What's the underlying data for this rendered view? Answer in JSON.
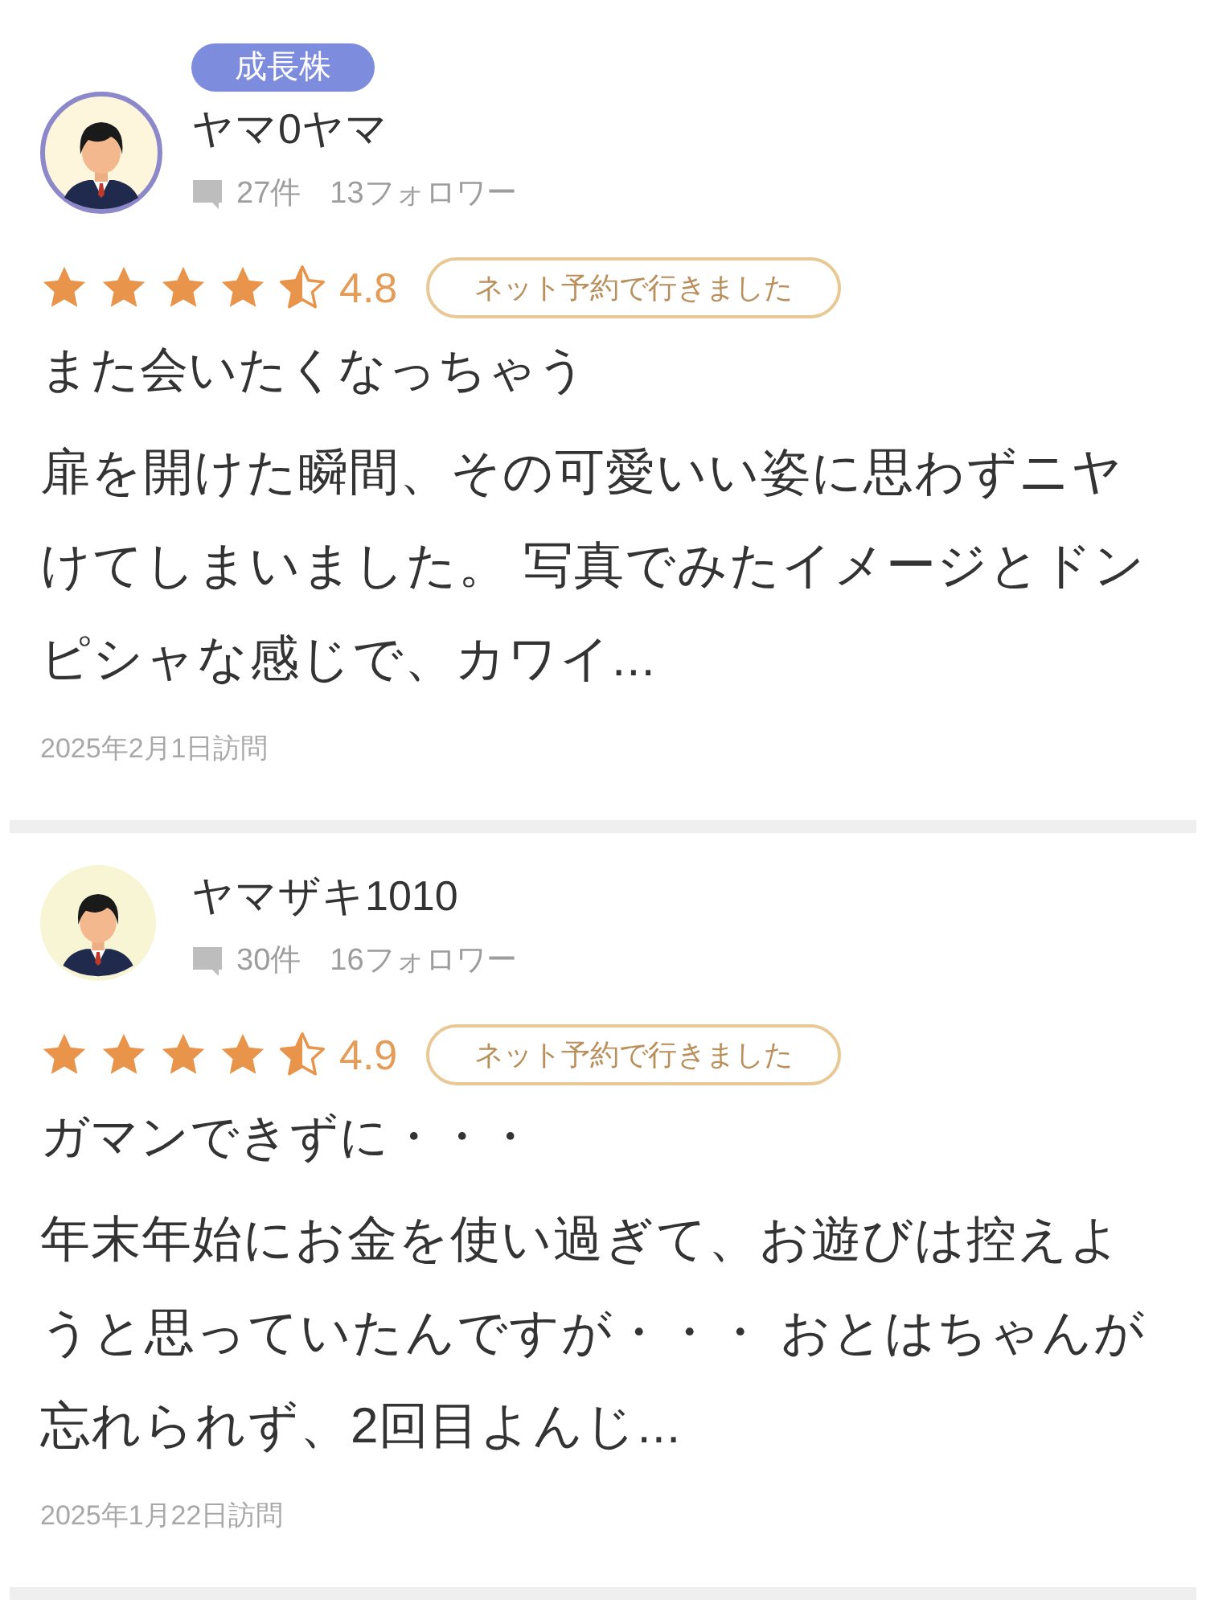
{
  "reviews": [
    {
      "badge": "成長株",
      "name": "ヤマ0ヤマ",
      "review_count": "27件",
      "followers": "13フォロワー",
      "stars": 4.5,
      "rating": "4.8",
      "tag": "ネット予約で行きました",
      "title": "また会いたくなっちゃう",
      "body": "扉を開けた瞬間、その可愛いい姿に思わずニヤけてしまいました。 写真でみたイメージとドンピシャな感じで、カワイ...",
      "visit_date": "2025年2月1日訪問"
    },
    {
      "name": "ヤマザキ1010",
      "review_count": "30件",
      "followers": "16フォロワー",
      "stars": 4.5,
      "rating": "4.9",
      "tag": "ネット予約で行きました",
      "title": "ガマンできずに・・・",
      "body": "年末年始にお金を使い過ぎて、お遊びは控えようと思っていたんですが・・・ おとはちゃんが忘れられず、2回目よんじ...",
      "visit_date": "2025年1月22日訪問"
    }
  ]
}
